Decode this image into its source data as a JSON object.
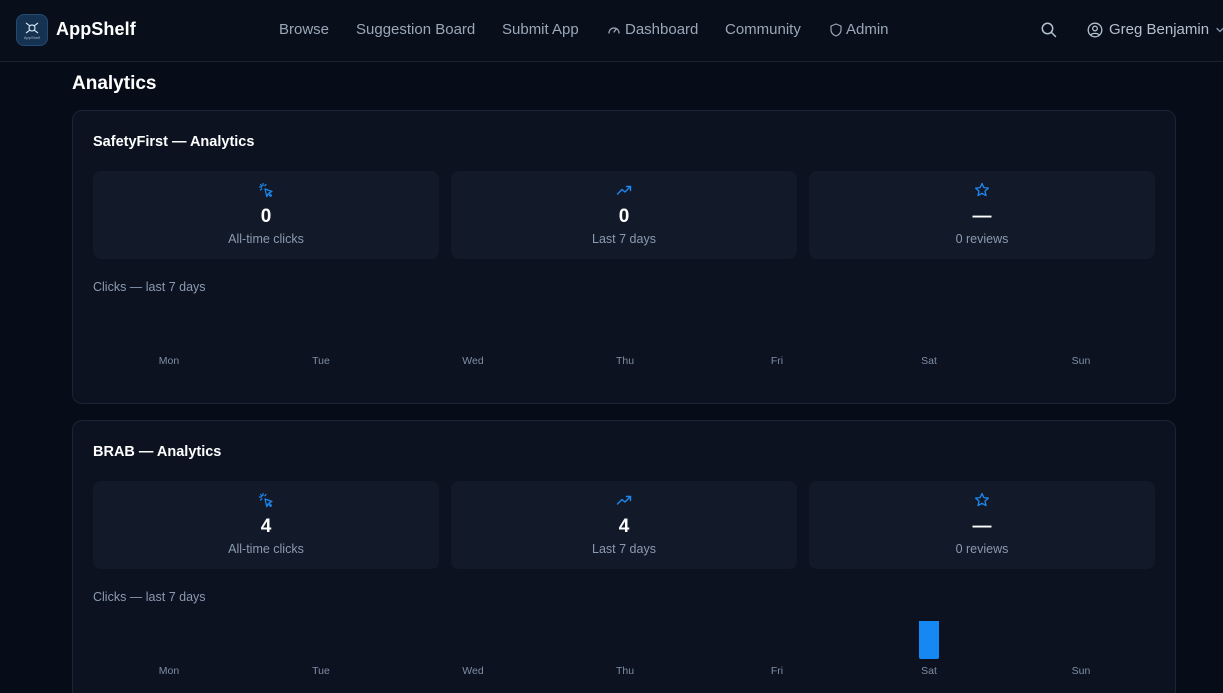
{
  "app": {
    "name": "AppShelf",
    "logo_caption": "AppShelf"
  },
  "nav": {
    "links": [
      {
        "label": "Browse"
      },
      {
        "label": "Suggestion Board"
      },
      {
        "label": "Submit App"
      },
      {
        "label": "Dashboard"
      },
      {
        "label": "Community"
      },
      {
        "label": "Admin"
      }
    ],
    "user_name": "Greg Benjamin"
  },
  "page": {
    "title": "Analytics"
  },
  "colors": {
    "accent": "#1e88f0",
    "bar": "#1588f4",
    "background": "#070d18",
    "card": "#0c1220",
    "stat": "#121a29"
  },
  "cards": [
    {
      "title": "SafetyFirst — Analytics",
      "stats": [
        {
          "icon": "cursor-click-icon",
          "value": "0",
          "label": "All-time clicks"
        },
        {
          "icon": "trending-up-icon",
          "value": "0",
          "label": "Last 7 days"
        },
        {
          "icon": "star-icon",
          "value": "—",
          "label": "0 reviews"
        }
      ],
      "chart_caption": "Clicks — last 7 days",
      "chart_data": {
        "type": "bar",
        "categories": [
          "Mon",
          "Tue",
          "Wed",
          "Thu",
          "Fri",
          "Sat",
          "Sun"
        ],
        "values": [
          0,
          0,
          0,
          0,
          0,
          0,
          0
        ]
      }
    },
    {
      "title": "BRAB — Analytics",
      "stats": [
        {
          "icon": "cursor-click-icon",
          "value": "4",
          "label": "All-time clicks"
        },
        {
          "icon": "trending-up-icon",
          "value": "4",
          "label": "Last 7 days"
        },
        {
          "icon": "star-icon",
          "value": "—",
          "label": "0 reviews"
        }
      ],
      "chart_caption": "Clicks — last 7 days",
      "chart_data": {
        "type": "bar",
        "categories": [
          "Mon",
          "Tue",
          "Wed",
          "Thu",
          "Fri",
          "Sat",
          "Sun"
        ],
        "values": [
          0,
          0,
          0,
          0,
          0,
          4,
          0
        ]
      }
    }
  ]
}
